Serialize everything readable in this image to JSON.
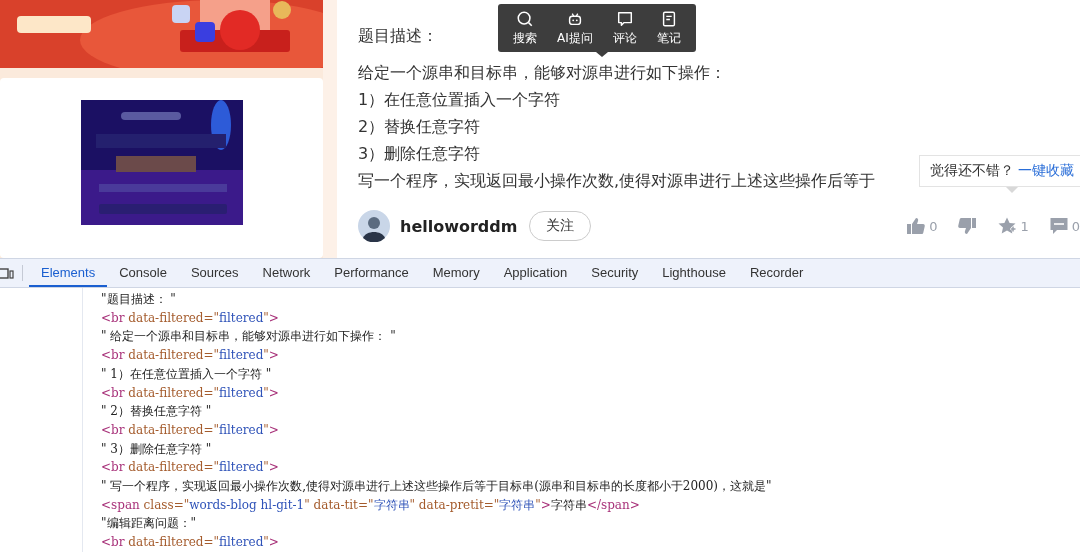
{
  "article": {
    "lines": [
      "题目描述：",
      "给定一个源串和目标串，能够对源串进行如下操作：",
      "1）在任意位置插入一个字符",
      "2）替换任意字符",
      "3）删除任意字符",
      "写一个程序，实现返回最小操作次数,使得对源串进行上述这些操作后等于"
    ]
  },
  "selection_toolbar": {
    "items": [
      {
        "kind": "search",
        "label": "搜索"
      },
      {
        "kind": "robot",
        "label": "AI提问"
      },
      {
        "kind": "comment",
        "label": "评论"
      },
      {
        "kind": "note",
        "label": "笔记"
      }
    ]
  },
  "tooltip": {
    "text": "觉得还不错？",
    "link": "一键收藏"
  },
  "author": {
    "name": "helloworddm",
    "follow_label": "关注"
  },
  "actions": [
    {
      "kind": "like",
      "count": "0"
    },
    {
      "kind": "dislike"
    },
    {
      "kind": "favorite",
      "count": "1"
    },
    {
      "kind": "comment",
      "count": "0"
    }
  ],
  "devtools": {
    "tabs": [
      {
        "label": "Elements",
        "selected": true
      },
      {
        "label": "Console",
        "selected": false
      },
      {
        "label": "Sources",
        "selected": false
      },
      {
        "label": "Network",
        "selected": false
      },
      {
        "label": "Performance",
        "selected": false
      },
      {
        "label": "Memory",
        "selected": false
      },
      {
        "label": "Application",
        "selected": false
      },
      {
        "label": "Security",
        "selected": false
      },
      {
        "label": "Lighthouse",
        "selected": false
      },
      {
        "label": "Recorder",
        "selected": false
      }
    ],
    "lines": [
      {
        "parts": [
          {
            "t": "\"题目描述： \"",
            "kind": "text"
          }
        ]
      },
      {
        "parts": [
          {
            "t": "<br",
            "kind": "tag"
          },
          {
            "t": " data-filtered=\"",
            "kind": "attr"
          },
          {
            "t": "filtered",
            "kind": "value"
          },
          {
            "t": "\"",
            "kind": "attr"
          },
          {
            "t": ">",
            "kind": "tag"
          }
        ]
      },
      {
        "parts": [
          {
            "t": "\" 给定一个源串和目标串，能够对源串进行如下操作： \"",
            "kind": "text"
          }
        ]
      },
      {
        "parts": [
          {
            "t": "<br",
            "kind": "tag"
          },
          {
            "t": " data-filtered=\"",
            "kind": "attr"
          },
          {
            "t": "filtered",
            "kind": "value"
          },
          {
            "t": "\"",
            "kind": "attr"
          },
          {
            "t": ">",
            "kind": "tag"
          }
        ]
      },
      {
        "parts": [
          {
            "t": "\" 1）在任意位置插入一个字符 \"",
            "kind": "text"
          }
        ]
      },
      {
        "parts": [
          {
            "t": "<br",
            "kind": "tag"
          },
          {
            "t": " data-filtered=\"",
            "kind": "attr"
          },
          {
            "t": "filtered",
            "kind": "value"
          },
          {
            "t": "\"",
            "kind": "attr"
          },
          {
            "t": ">",
            "kind": "tag"
          }
        ]
      },
      {
        "parts": [
          {
            "t": "\" 2）替换任意字符 \"",
            "kind": "text"
          }
        ]
      },
      {
        "parts": [
          {
            "t": "<br",
            "kind": "tag"
          },
          {
            "t": " data-filtered=\"",
            "kind": "attr"
          },
          {
            "t": "filtered",
            "kind": "value"
          },
          {
            "t": "\"",
            "kind": "attr"
          },
          {
            "t": ">",
            "kind": "tag"
          }
        ]
      },
      {
        "parts": [
          {
            "t": "\" 3）删除任意字符 \"",
            "kind": "text"
          }
        ]
      },
      {
        "parts": [
          {
            "t": "<br",
            "kind": "tag"
          },
          {
            "t": " data-filtered=\"",
            "kind": "attr"
          },
          {
            "t": "filtered",
            "kind": "value"
          },
          {
            "t": "\"",
            "kind": "attr"
          },
          {
            "t": ">",
            "kind": "tag"
          }
        ]
      },
      {
        "parts": [
          {
            "t": "\" 写一个程序，实现返回最小操作次数,使得对源串进行上述这些操作后等于目标串(源串和目标串的长度都小于2000)，这就是\"",
            "kind": "text"
          }
        ]
      },
      {
        "parts": [
          {
            "t": "<span",
            "kind": "tag"
          },
          {
            "t": " class=\"",
            "kind": "attr"
          },
          {
            "t": "words-blog hl-git-1",
            "kind": "value"
          },
          {
            "t": "\" data-tit=\"",
            "kind": "attr"
          },
          {
            "t": "字符串",
            "kind": "value"
          },
          {
            "t": "\" data-pretit=\"",
            "kind": "attr"
          },
          {
            "t": "字符串",
            "kind": "value"
          },
          {
            "t": "\"",
            "kind": "attr"
          },
          {
            "t": ">",
            "kind": "tag"
          },
          {
            "t": "字符串",
            "kind": "text"
          },
          {
            "t": "</span>",
            "kind": "tag"
          }
        ]
      },
      {
        "parts": [
          {
            "t": "\"编辑距离问题：\"",
            "kind": "text"
          }
        ]
      },
      {
        "parts": [
          {
            "t": "<br",
            "kind": "tag"
          },
          {
            "t": " data-filtered=\"",
            "kind": "attr"
          },
          {
            "t": "filtered",
            "kind": "value"
          },
          {
            "t": "\"",
            "kind": "attr"
          },
          {
            "t": ">",
            "kind": "tag"
          }
        ]
      }
    ]
  }
}
